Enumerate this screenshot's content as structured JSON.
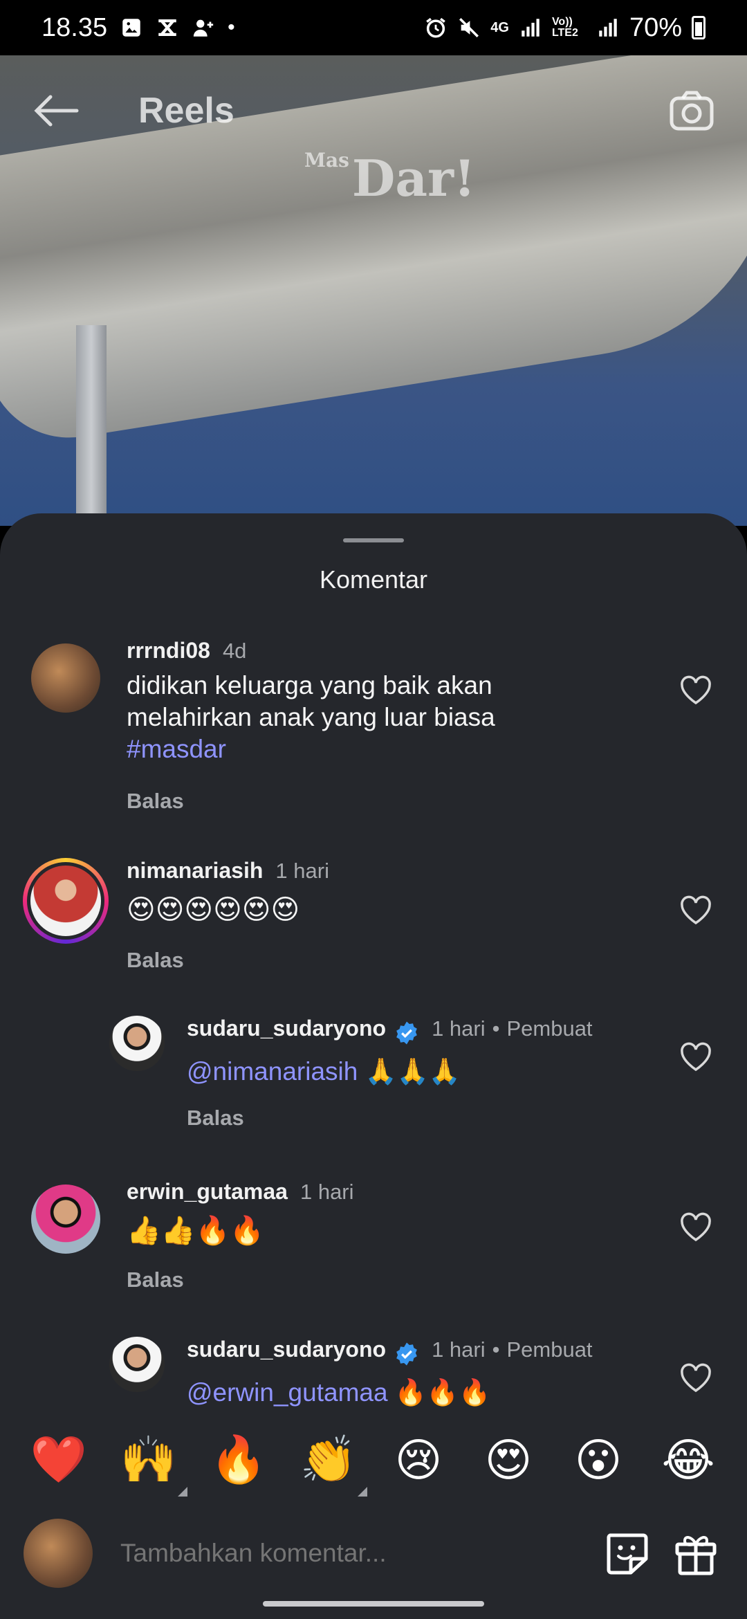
{
  "status_bar": {
    "time": "18.35",
    "network_4g": "4G",
    "volte": "Vo)) LTE2",
    "battery": "70%"
  },
  "header": {
    "title": "Reels",
    "watermark_small": "Mas",
    "watermark": "Dar!"
  },
  "sheet": {
    "title": "Komentar"
  },
  "comments": [
    {
      "username": "rrrndi08",
      "time": "4d",
      "text_lines": [
        "didikan keluarga yang baik akan",
        "melahirkan anak yang luar biasa"
      ],
      "hashtag": "#masdar",
      "reply_label": "Balas"
    },
    {
      "username": "nimanariasih",
      "time": "1 hari",
      "text": "😍😍😍😍😍😍",
      "reply_label": "Balas"
    },
    {
      "username": "sudaru_sudaryono",
      "time": "1 hari",
      "creator_label": "Pembuat",
      "mention": "@nimanariasih",
      "text": "🙏🙏🙏",
      "reply_label": "Balas"
    },
    {
      "username": "erwin_gutamaa",
      "time": "1 hari",
      "text": "👍👍🔥🔥",
      "reply_label": "Balas"
    },
    {
      "username": "sudaru_sudaryono",
      "time": "1 hari",
      "creator_label": "Pembuat",
      "mention": "@erwin_gutamaa",
      "text": "🔥🔥🔥"
    }
  ],
  "emoji_bar": [
    "❤️",
    "🙌",
    "🔥",
    "👏",
    "😢",
    "😍",
    "😮",
    "😂"
  ],
  "input": {
    "placeholder": "Tambahkan komentar..."
  },
  "colors": {
    "sheet_bg": "#25272c",
    "link": "#8f94ff",
    "verified": "#3897f0"
  }
}
